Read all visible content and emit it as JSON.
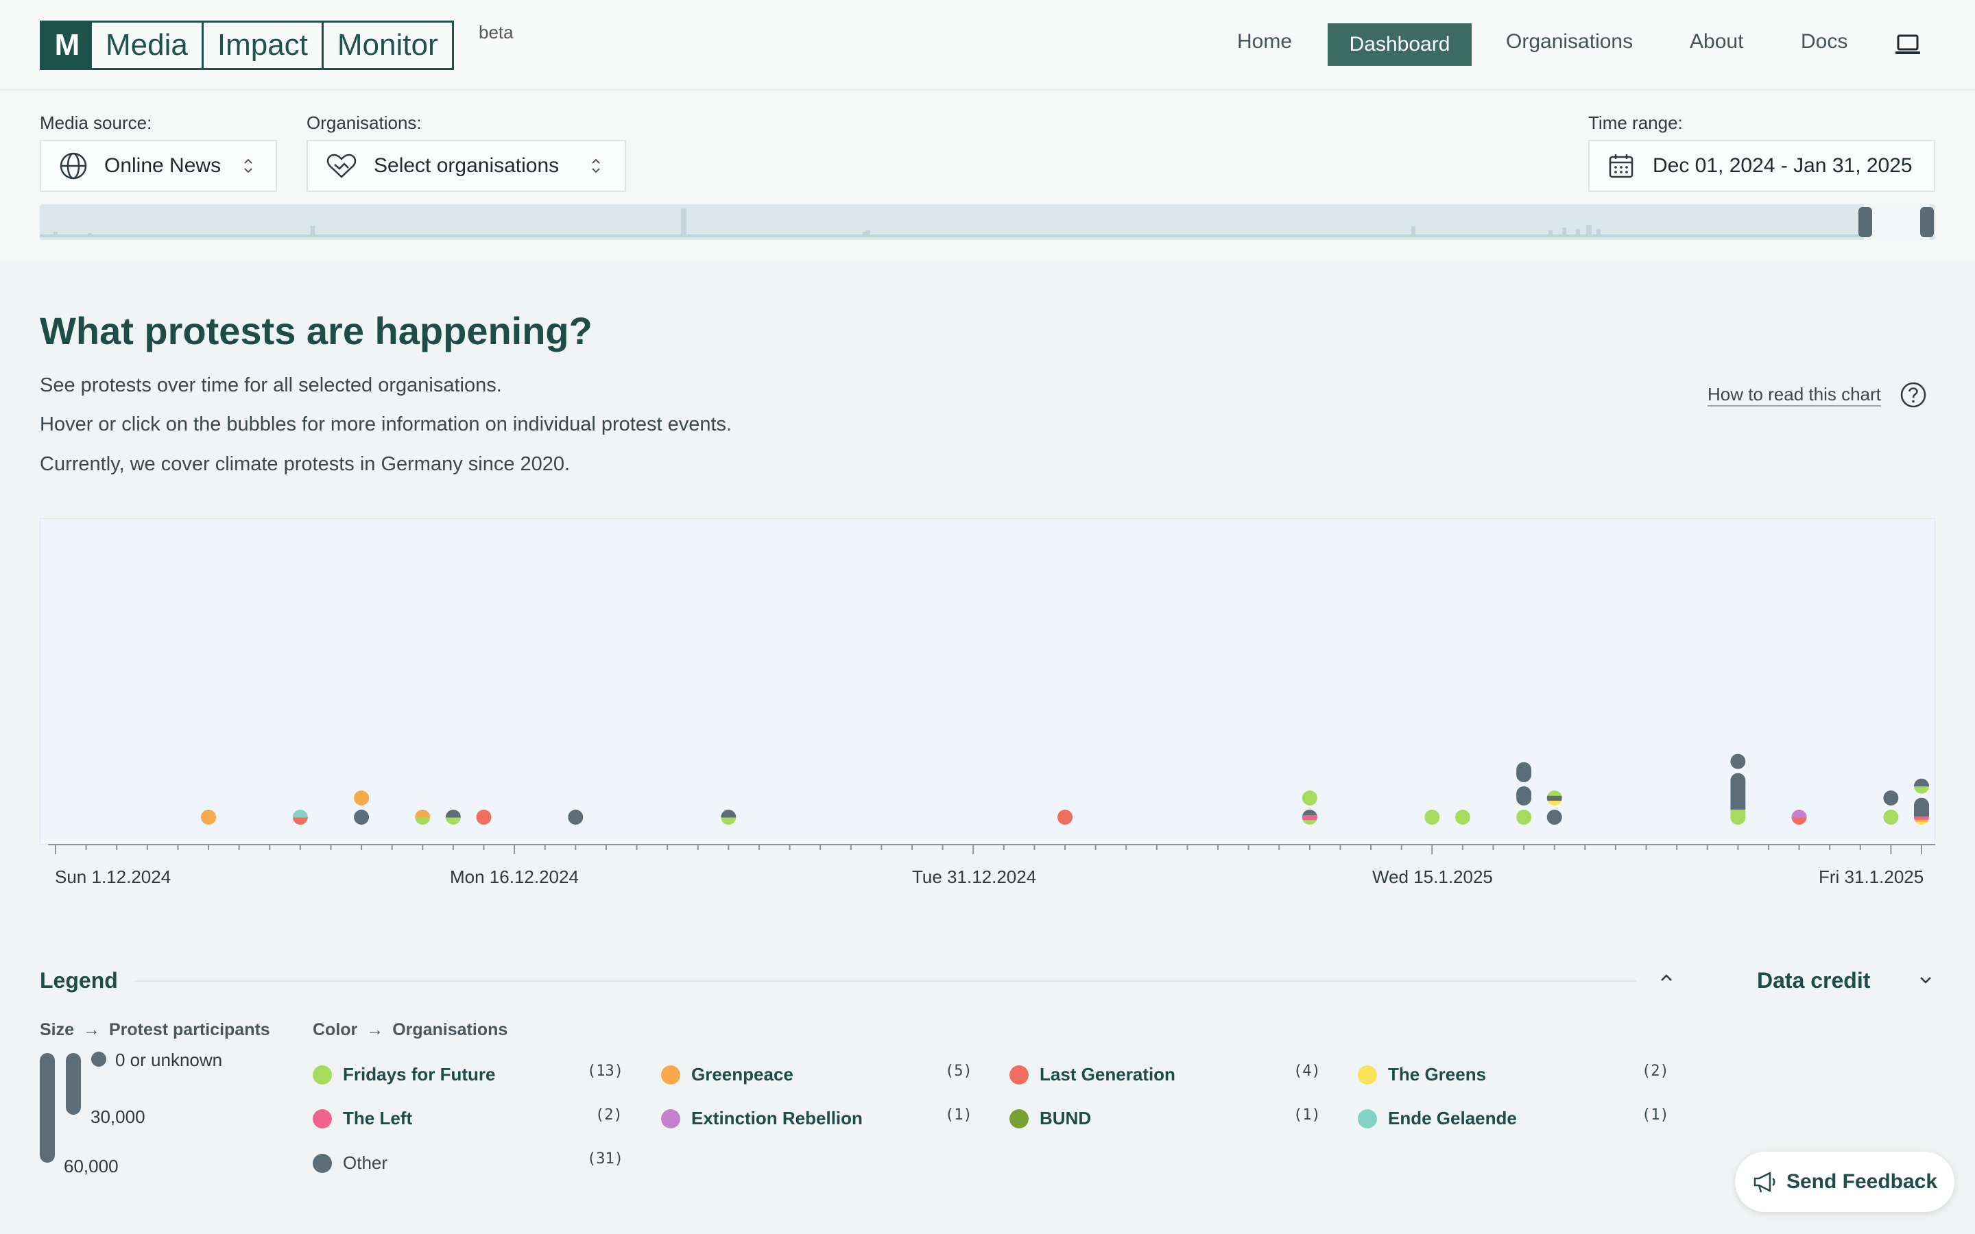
{
  "header": {
    "logo_mark": "M",
    "logo_words": [
      "Media",
      "Impact",
      "Monitor"
    ],
    "beta": "beta",
    "nav": [
      "Home",
      "Dashboard",
      "Organisations",
      "About",
      "Docs"
    ],
    "active_nav": "Dashboard"
  },
  "filters": {
    "media_source_label": "Media source:",
    "media_source_value": "Online News",
    "organisations_label": "Organisations:",
    "organisations_value": "Select organisations",
    "time_range_label": "Time range:",
    "time_range_value": "Dec 01, 2024 - Jan 31, 2025"
  },
  "section": {
    "title": "What protests are happening?",
    "desc1": "See protests over time for all selected organisations.",
    "desc2": "Hover or click on the bubbles for more information on individual protest events.",
    "desc3": "Currently, we cover climate protests in Germany since 2020.",
    "howto": "How to read this chart"
  },
  "chart_data": {
    "type": "scatter",
    "x_ticks": [
      "Sun 1.12.2024",
      "Mon 16.12.2024",
      "Tue 31.12.2024",
      "Wed 15.1.2025",
      "Fri 31.1.2025"
    ],
    "x_range": [
      "2024-12-01",
      "2025-01-31"
    ],
    "colors": {
      "Fridays for Future": "#a6dc5c",
      "Greenpeace": "#f9a84a",
      "Last Generation": "#f26d5f",
      "The Greens": "#fbe35a",
      "The Left": "#f2628f",
      "Extinction Rebellion": "#c77fcf",
      "BUND": "#7a9f32",
      "Ende Gelaende": "#83d3c4",
      "Other": "#5d6d78"
    },
    "events": [
      {
        "date": "2024-12-06",
        "stack": [
          [
            "Greenpeace",
            1
          ]
        ]
      },
      {
        "date": "2024-12-09",
        "stack": [
          [
            "Last Generation",
            0.5
          ],
          [
            "Ende Gelaende",
            0.5
          ]
        ]
      },
      {
        "date": "2024-12-11",
        "stack": [
          [
            "Other",
            1
          ]
        ]
      },
      {
        "date": "2024-12-11",
        "stack": [
          [
            "Greenpeace",
            1
          ]
        ],
        "level": 1
      },
      {
        "date": "2024-12-13",
        "stack": [
          [
            "Fridays for Future",
            0.5
          ],
          [
            "Greenpeace",
            0.5
          ]
        ]
      },
      {
        "date": "2024-12-14",
        "stack": [
          [
            "Fridays for Future",
            0.5
          ],
          [
            "Other",
            0.5
          ]
        ]
      },
      {
        "date": "2024-12-15",
        "stack": [
          [
            "Last Generation",
            1
          ]
        ]
      },
      {
        "date": "2024-12-18",
        "stack": [
          [
            "Other",
            1
          ]
        ]
      },
      {
        "date": "2024-12-23",
        "stack": [
          [
            "Fridays for Future",
            0.5
          ],
          [
            "Other",
            0.5
          ]
        ]
      },
      {
        "date": "2025-01-03",
        "stack": [
          [
            "Last Generation",
            1
          ]
        ]
      },
      {
        "date": "2025-01-11",
        "stack": [
          [
            "Fridays for Future",
            0.33
          ],
          [
            "The Left",
            0.33
          ],
          [
            "Other",
            0.34
          ]
        ]
      },
      {
        "date": "2025-01-11",
        "stack": [
          [
            "Fridays for Future",
            1
          ]
        ],
        "level": 1
      },
      {
        "date": "2025-01-15",
        "stack": [
          [
            "Fridays for Future",
            1
          ]
        ]
      },
      {
        "date": "2025-01-16",
        "stack": [
          [
            "Fridays for Future",
            1
          ]
        ]
      },
      {
        "date": "2025-01-18",
        "stack": [
          [
            "Fridays for Future",
            1
          ]
        ]
      },
      {
        "date": "2025-01-18",
        "stack": [
          [
            "Other",
            1
          ]
        ],
        "level": 1,
        "size": 1800
      },
      {
        "date": "2025-01-18",
        "stack": [
          [
            "Other",
            1
          ]
        ],
        "level": 2,
        "size": 2200
      },
      {
        "date": "2025-01-19",
        "stack": [
          [
            "Other",
            1
          ]
        ]
      },
      {
        "date": "2025-01-19",
        "stack": [
          [
            "The Greens",
            0.34
          ],
          [
            "Other",
            0.33
          ],
          [
            "Fridays for Future",
            0.33
          ]
        ],
        "level": 1
      },
      {
        "date": "2025-01-25",
        "stack": [
          [
            "Fridays for Future",
            0.3
          ],
          [
            "Other",
            0.7
          ]
        ],
        "size": 16000
      },
      {
        "date": "2025-01-25",
        "stack": [
          [
            "Other",
            1
          ]
        ],
        "level": 1,
        "top": true
      },
      {
        "date": "2025-01-27",
        "stack": [
          [
            "Last Generation",
            0.5
          ],
          [
            "Extinction Rebellion",
            0.5
          ]
        ]
      },
      {
        "date": "2025-01-30",
        "stack": [
          [
            "Fridays for Future",
            1
          ]
        ]
      },
      {
        "date": "2025-01-30",
        "stack": [
          [
            "Other",
            1
          ]
        ],
        "level": 1
      },
      {
        "date": "2025-01-31",
        "stack": [
          [
            "The Greens",
            0.12
          ],
          [
            "Greenpeace",
            0.08
          ],
          [
            "The Left",
            0.12
          ],
          [
            "Other",
            0.68
          ]
        ],
        "size": 5200
      },
      {
        "date": "2025-01-31",
        "stack": [
          [
            "Fridays for Future",
            0.5
          ],
          [
            "Other",
            0.5
          ]
        ],
        "level": 1,
        "top": true
      }
    ]
  },
  "legend": {
    "title": "Legend",
    "size_heading": "Size",
    "size_subheading": "Protest participants",
    "size_labels": [
      "0 or unknown",
      "30,000",
      "60,000"
    ],
    "color_heading": "Color",
    "color_subheading": "Organisations",
    "items": [
      {
        "name": "Fridays for Future",
        "count": "(13)",
        "color": "#a6dc5c"
      },
      {
        "name": "Greenpeace",
        "count": "(5)",
        "color": "#f9a84a"
      },
      {
        "name": "Last Generation",
        "count": "(4)",
        "color": "#f26d5f"
      },
      {
        "name": "The Greens",
        "count": "(2)",
        "color": "#fbe35a"
      },
      {
        "name": "The Left",
        "count": "(2)",
        "color": "#f2628f"
      },
      {
        "name": "Extinction Rebellion",
        "count": "(1)",
        "color": "#c77fcf"
      },
      {
        "name": "BUND",
        "count": "(1)",
        "color": "#7a9f32"
      },
      {
        "name": "Ende Gelaende",
        "count": "(1)",
        "color": "#83d3c4"
      },
      {
        "name": "Other",
        "count": "(31)",
        "color": "#5d6d78"
      }
    ]
  },
  "credit": {
    "title": "Data credit"
  },
  "feedback": {
    "label": "Send Feedback"
  }
}
